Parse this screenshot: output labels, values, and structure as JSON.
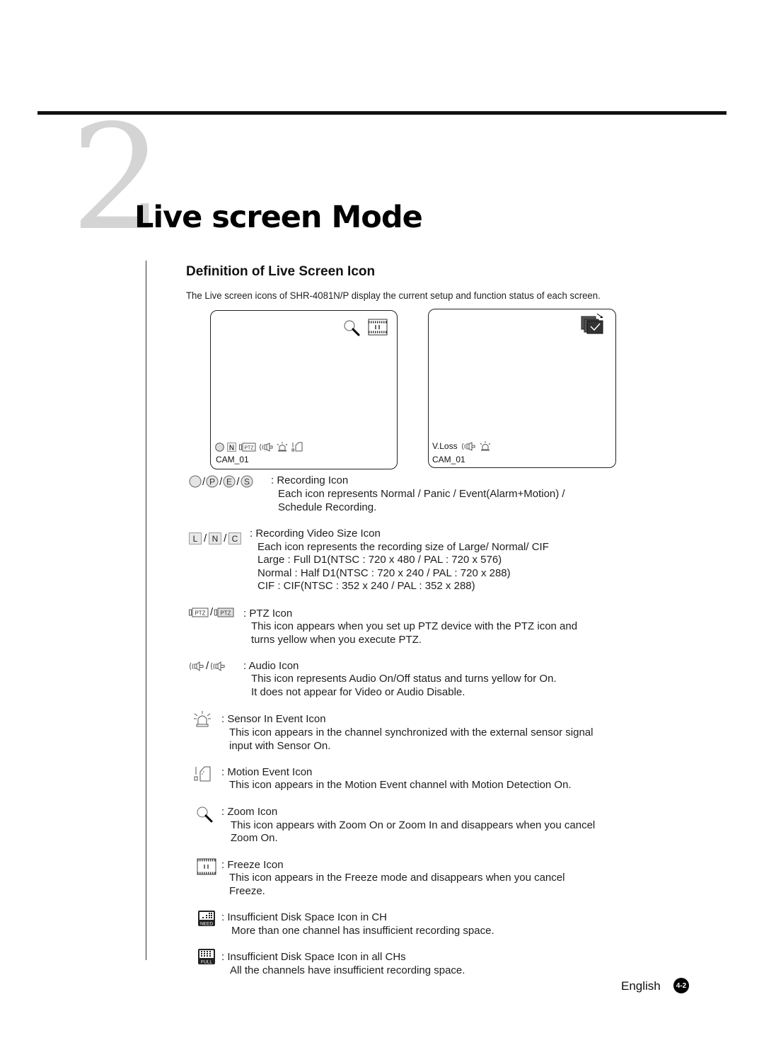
{
  "chapter": {
    "number": "2",
    "title": "Live screen Mode"
  },
  "section": {
    "title": "Definition of Live Screen Icon",
    "intro": "The Live screen icons of SHR-4081N/P display the current setup and function status of each screen."
  },
  "screens": [
    {
      "top_icons": [
        "zoom-icon",
        "freeze-icon"
      ],
      "status_icons": [
        "recording-normal-icon",
        "video-size-normal-icon",
        "ptz-icon",
        "audio-icon",
        "sensor-event-icon",
        "motion-event-icon"
      ],
      "camera_label": "CAM_01"
    },
    {
      "top_icons": [
        "sequence-check-icon"
      ],
      "status_text": "V.Loss",
      "status_icons": [
        "audio-icon",
        "sensor-event-icon"
      ],
      "camera_label": "CAM_01"
    }
  ],
  "icon_definitions": [
    {
      "icons": [
        "recording-normal",
        "recording-panic",
        "recording-event",
        "recording-schedule"
      ],
      "icon_letters": [
        "",
        "P",
        "E",
        "S"
      ],
      "label": ": Recording Icon",
      "lines": [
        "Each icon represents Normal / Panic / Event(Alarm+Motion) /",
        "Schedule Recording."
      ]
    },
    {
      "icons": [
        "size-large",
        "size-normal",
        "size-cif"
      ],
      "icon_letters": [
        "L",
        "N",
        "C"
      ],
      "label": ": Recording Video Size Icon",
      "lines": [
        "Each icon represents the recording size of Large/ Normal/ CIF",
        "Large : Full D1(NTSC : 720 x 480 / PAL : 720 x 576)",
        "Normal : Half D1(NTSC : 720 x 240 / PAL : 720 x 288)",
        "CIF : CIF(NTSC : 352 x 240 / PAL : 352 x 288)"
      ]
    },
    {
      "icons": [
        "ptz-off",
        "ptz-on"
      ],
      "icon_text": "PTZ",
      "label": ": PTZ Icon",
      "lines": [
        "This icon appears when you set up PTZ device with the PTZ icon and",
        "turns yellow when you execute PTZ."
      ]
    },
    {
      "icons": [
        "audio-off",
        "audio-on"
      ],
      "label": ": Audio Icon",
      "lines": [
        "This icon represents Audio On/Off status and turns yellow for On.",
        "It does not appear for Video or Audio Disable."
      ]
    },
    {
      "icons": [
        "sensor-event"
      ],
      "label": ": Sensor In Event Icon",
      "lines": [
        "This icon appears in the channel synchronized with the external sensor signal",
        "input with Sensor On."
      ]
    },
    {
      "icons": [
        "motion-event"
      ],
      "label": ": Motion Event Icon",
      "lines": [
        "This icon appears in the Motion Event channel with Motion Detection On."
      ]
    },
    {
      "icons": [
        "zoom"
      ],
      "label": ": Zoom Icon",
      "lines": [
        "This icon appears with Zoom On or Zoom In and disappears when you cancel",
        "Zoom On."
      ]
    },
    {
      "icons": [
        "freeze"
      ],
      "label": ": Freeze Icon",
      "lines": [
        "This icon appears in the Freeze mode and disappears when you cancel",
        "Freeze."
      ]
    },
    {
      "icons": [
        "disk-need"
      ],
      "icon_text": "NEED",
      "label": ": Insufficient Disk Space Icon in CH",
      "lines": [
        "More than one channel has insufficient recording space."
      ]
    },
    {
      "icons": [
        "disk-full"
      ],
      "icon_text": "FULL",
      "label": ": Insufficient Disk Space Icon in all CHs",
      "lines": [
        "All the channels have insufficient recording space."
      ]
    }
  ],
  "footer": {
    "language": "English",
    "page": "4-2"
  },
  "colors": {
    "chapter_number": "#d4d4d4",
    "text": "#1a1a1a",
    "badge_bg": "#000000"
  }
}
